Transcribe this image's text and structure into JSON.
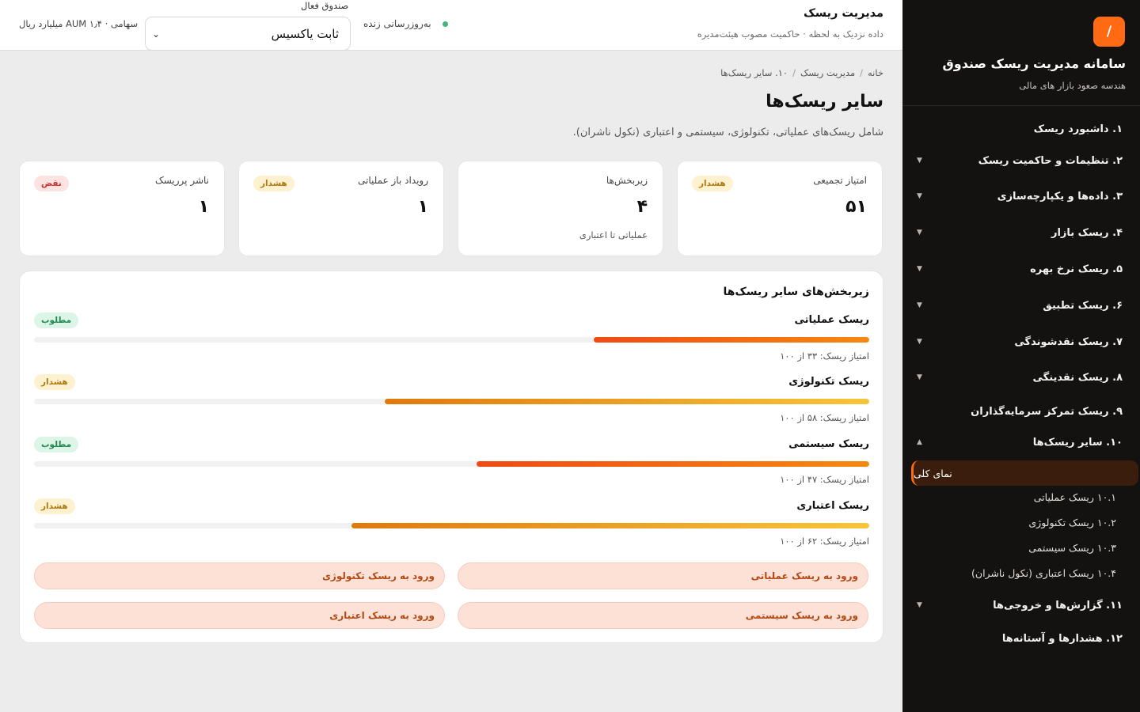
{
  "sidebar": {
    "logo": "/",
    "title": "سامانه مدیریت ریسک صندوق",
    "subtitle": "هندسه صعود بازار های مالی",
    "items": [
      {
        "label": "۱. داشبورد ریسک"
      },
      {
        "label": "۲. تنظیمات و حاکمیت ریسک"
      },
      {
        "label": "۳. داده‌ها و یکپارچه‌سازی"
      },
      {
        "label": "۴. ریسک بازار"
      },
      {
        "label": "۵. ریسک نرخ بهره"
      },
      {
        "label": "۶. ریسک تطبیق"
      },
      {
        "label": "۷. ریسک نقدشوندگی"
      },
      {
        "label": "۸. ریسک نقدینگی"
      },
      {
        "label": "۹. ریسک تمرکز سرمایه‌گذاران"
      },
      {
        "label": "۱۰. سایر ریسک‌ها"
      },
      {
        "label": "۱۱. گزارش‌ها و خروجی‌ها"
      },
      {
        "label": "۱۲. هشدارها و آستانه‌ها"
      }
    ],
    "subitems": [
      {
        "label": "نمای کلی"
      },
      {
        "label": "۱۰.۱ ریسک عملیاتی"
      },
      {
        "label": "۱۰.۲ ریسک تکنولوژی"
      },
      {
        "label": "۱۰.۳ ریسک سیستمی"
      },
      {
        "label": "۱۰.۴ ریسک اعتباری (نکول ناشران)"
      }
    ]
  },
  "header": {
    "title": "مدیریت ریسک",
    "subtitle": "داده نزدیک به لحظه · حاکمیت مصوب هیئت‌مدیره",
    "live_label": "به‌روزرسانی زنده",
    "fund_label": "صندوق فعال",
    "fund_value": "ثابت یاکسیس",
    "aum": "سهامی · AUM ۱٫۴ میلیارد ریال"
  },
  "breadcrumb": {
    "home": "خانه",
    "section": "مدیریت ریسک",
    "current": "۱۰. سایر ریسک‌ها"
  },
  "page": {
    "title": "سایر ریسک‌ها",
    "description": "شامل ریسک‌های عملیاتی، تکنولوژی، سیستمی و اعتباری (نکول ناشران)."
  },
  "kpis": [
    {
      "label": "امتیاز تجمیعی",
      "value": "۵۱",
      "badge": "هشدار",
      "note": ""
    },
    {
      "label": "زیربخش‌ها",
      "value": "۴",
      "badge": "",
      "note": "عملیاتی تا اعتباری"
    },
    {
      "label": "رویداد باز عملیاتی",
      "value": "۱",
      "badge": "هشدار",
      "note": ""
    },
    {
      "label": "ناشر پرریسک",
      "value": "۱",
      "badge": "نقض",
      "note": ""
    }
  ],
  "panel": {
    "title": "زیربخش‌های سایر ریسک‌ها",
    "risks": [
      {
        "name": "ریسک عملیاتی",
        "score": 33,
        "score_text": "امتیاز ریسک: ۳۳ از ۱۰۰",
        "badge": "مطلوب"
      },
      {
        "name": "ریسک تکنولوژی",
        "score": 58,
        "score_text": "امتیاز ریسک: ۵۸ از ۱۰۰",
        "badge": "هشدار"
      },
      {
        "name": "ریسک سیستمی",
        "score": 47,
        "score_text": "امتیاز ریسک: ۴۷ از ۱۰۰",
        "badge": "مطلوب"
      },
      {
        "name": "ریسک اعتباری",
        "score": 62,
        "score_text": "امتیاز ریسک: ۶۲ از ۱۰۰",
        "badge": "هشدار"
      }
    ],
    "buttons": [
      {
        "label": "ورود به ریسک عملیاتی"
      },
      {
        "label": "ورود به ریسک تکنولوژی"
      },
      {
        "label": "ورود به ریسک سیستمی"
      },
      {
        "label": "ورود به ریسک اعتباری"
      }
    ]
  },
  "colors": {
    "accent": "#ff6a13",
    "sidebar_bg": "#141211",
    "warn": "#b07912",
    "breach": "#c8322f",
    "ok": "#1f8a50"
  }
}
